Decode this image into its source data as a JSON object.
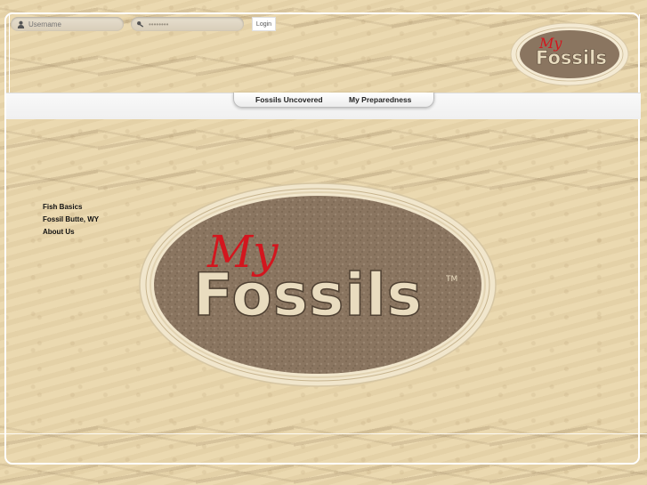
{
  "header": {
    "username_placeholder": "Username",
    "password_value": "••••••••",
    "login_label": "Login"
  },
  "nav": {
    "items": [
      {
        "label": "Fossils Uncovered"
      },
      {
        "label": "My Preparedness"
      }
    ]
  },
  "sidebar": {
    "items": [
      {
        "label": "Fish Basics"
      },
      {
        "label": "Fossil Butte, WY"
      },
      {
        "label": "About Us"
      }
    ]
  },
  "logo": {
    "script_text": "My",
    "main_text": "Fossils",
    "trademark": "TM"
  },
  "colors": {
    "background": "#ead7ad",
    "logo_oval": "#8a7560",
    "logo_rim": "#efe3c6",
    "logo_script": "#d3161e",
    "logo_letters": "#e9dcbf"
  },
  "icons": {
    "username": "user-icon",
    "password": "key-icon"
  }
}
